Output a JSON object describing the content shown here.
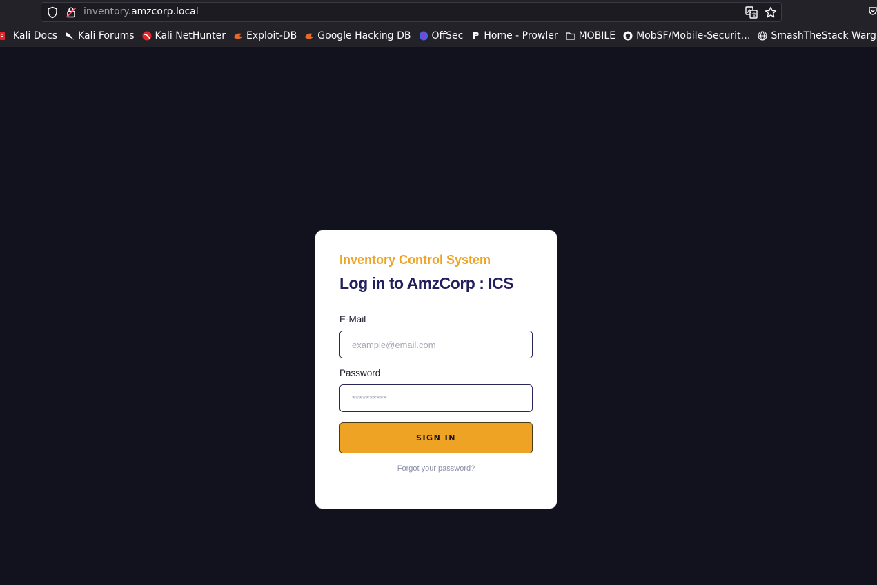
{
  "browser": {
    "url_prefix": "inventory.",
    "url_domain": "amzcorp.local",
    "bookmarks": [
      {
        "label": "Kali Docs",
        "icon": "kali-docs-icon"
      },
      {
        "label": "Kali Forums",
        "icon": "kali-dragon-icon"
      },
      {
        "label": "Kali NetHunter",
        "icon": "nethunter-icon"
      },
      {
        "label": "Exploit-DB",
        "icon": "exploit-db-icon"
      },
      {
        "label": "Google Hacking DB",
        "icon": "exploit-db-icon"
      },
      {
        "label": "OffSec",
        "icon": "offsec-icon"
      },
      {
        "label": "Home - Prowler",
        "icon": "prowler-icon"
      },
      {
        "label": "MOBILE",
        "icon": "folder-icon"
      },
      {
        "label": "MobSF/Mobile-Securit…",
        "icon": "github-icon"
      },
      {
        "label": "SmashTheStack Warg…",
        "icon": "globe-icon"
      }
    ]
  },
  "login": {
    "subtitle": "Inventory Control System",
    "title": "Log in to AmzCorp : ICS",
    "email_label": "E-Mail",
    "email_placeholder": "example@email.com",
    "password_label": "Password",
    "password_placeholder": "**********",
    "signin_label": "SIGN IN",
    "forgot_label": "Forgot your password?"
  },
  "colors": {
    "background": "#12111e",
    "accent": "#eea324",
    "title": "#221f5e"
  }
}
